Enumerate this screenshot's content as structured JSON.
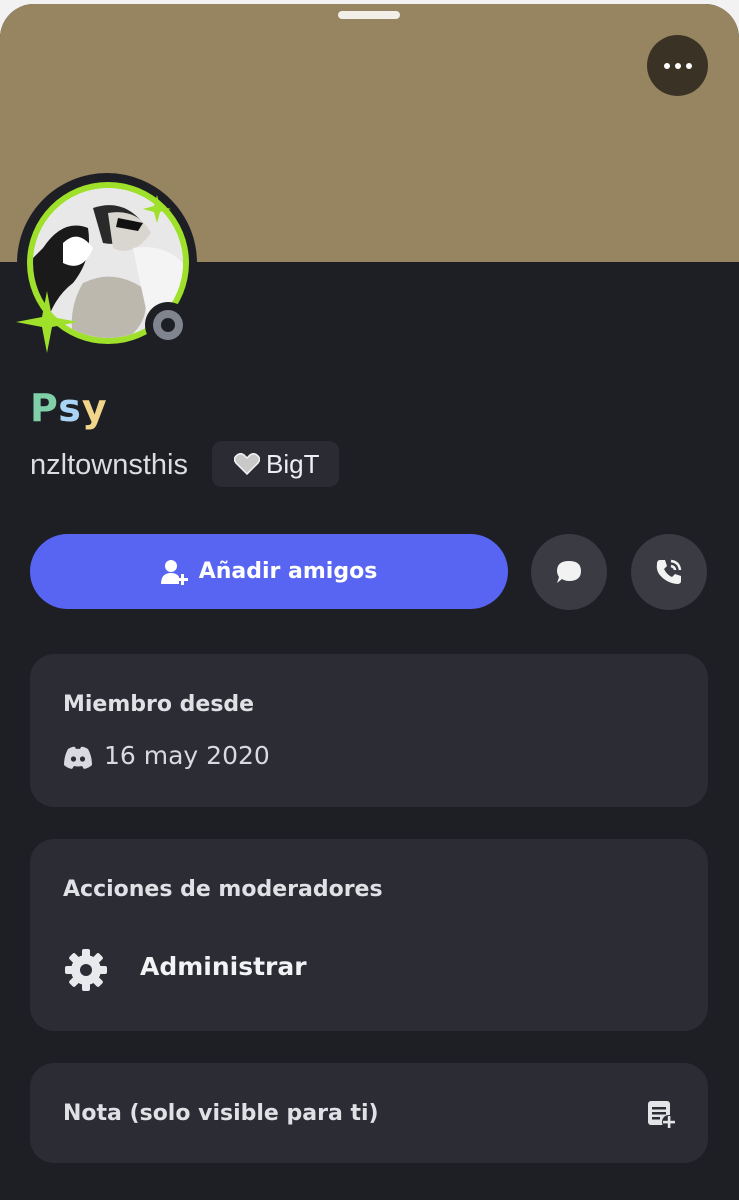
{
  "profile": {
    "display_name": [
      "P",
      "s",
      "y"
    ],
    "username": "nzltownsthis",
    "tag_label": "BigT"
  },
  "actions": {
    "add_friend_label": "Añadir amigos"
  },
  "member_card": {
    "title": "Miembro desde",
    "date": "16 may 2020"
  },
  "mod_card": {
    "title": "Acciones de moderadores",
    "manage_label": "Administrar"
  },
  "note_card": {
    "title": "Nota (solo visible para ti)"
  },
  "colors": {
    "banner": "#978562",
    "accent": "#5865f2",
    "background": "#1e1f24",
    "card": "#2b2c34",
    "avatar_ring": "#9ee02a"
  },
  "icons": [
    "more-icon",
    "status-offline-icon",
    "heart-icon",
    "add-friend-icon",
    "message-icon",
    "call-icon",
    "discord-icon",
    "gear-icon",
    "note-add-icon"
  ]
}
